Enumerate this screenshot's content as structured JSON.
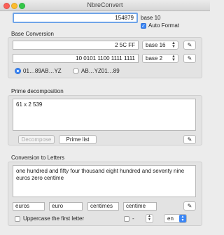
{
  "window": {
    "title": "NbreConvert"
  },
  "main": {
    "value": "154879",
    "base_label": "base 10",
    "auto_format_label": "Auto Format",
    "auto_format_checked": true
  },
  "base_conversion": {
    "title": "Base Conversion",
    "row1": {
      "value": "2 5C FF",
      "base": "base 16",
      "action_icon": "pencil-icon"
    },
    "row2": {
      "value": "10 0101 1100 1111 1111",
      "base": "base 2",
      "action_icon": "pencil-icon"
    },
    "radio1_label": "01…89AB…YZ",
    "radio2_label": "AB…YZ01…89",
    "radio_selected": 1
  },
  "prime": {
    "title": "Prime decomposition",
    "text": "61 x 2 539",
    "decompose_label": "Decompose",
    "prime_list_label": "Prime list",
    "action_icon": "pencil-icon"
  },
  "letters": {
    "title": "Conversion to Letters",
    "text": "one hundred and fifty four thousand eight hundred and seventy nine euros zero centime",
    "unit_plural": "euros",
    "unit_singular": "euro",
    "sub_plural": "centimes",
    "sub_singular": "centime",
    "uppercase_label": "Uppercase the first letter",
    "separator": "-",
    "language": "en",
    "action_icon": "pencil-icon"
  }
}
